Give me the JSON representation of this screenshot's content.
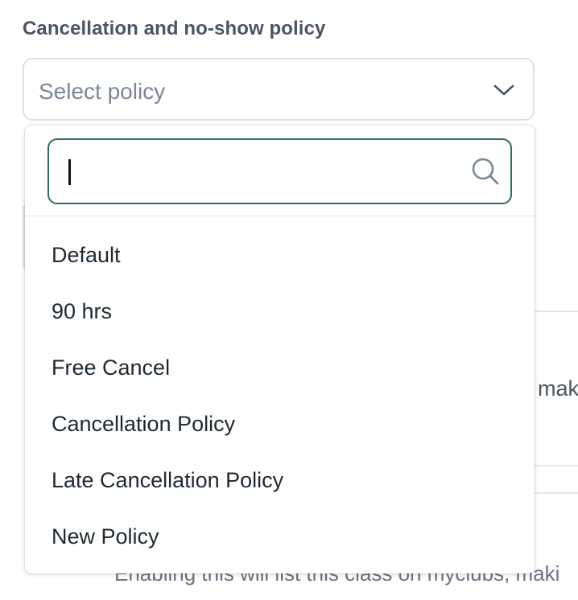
{
  "policy_field": {
    "label": "Cancellation and no-show policy",
    "placeholder": "Select policy",
    "chevron_icon": "chevron-down-icon"
  },
  "dropdown": {
    "search_value": "",
    "search_icon": "search-icon",
    "options": [
      {
        "label": "Default"
      },
      {
        "label": "90 hrs"
      },
      {
        "label": "Free Cancel"
      },
      {
        "label": "Cancellation Policy"
      },
      {
        "label": "Late Cancellation Policy"
      },
      {
        "label": "New Policy"
      }
    ]
  },
  "background": {
    "partial_text_1": "mak",
    "partial_text_2": "Enabling this will list this class on myclubs, maki"
  },
  "colors": {
    "focus_border": "#2a6f62",
    "label": "#4b5563",
    "placeholder": "#7b8794",
    "border": "#dde1e6"
  }
}
